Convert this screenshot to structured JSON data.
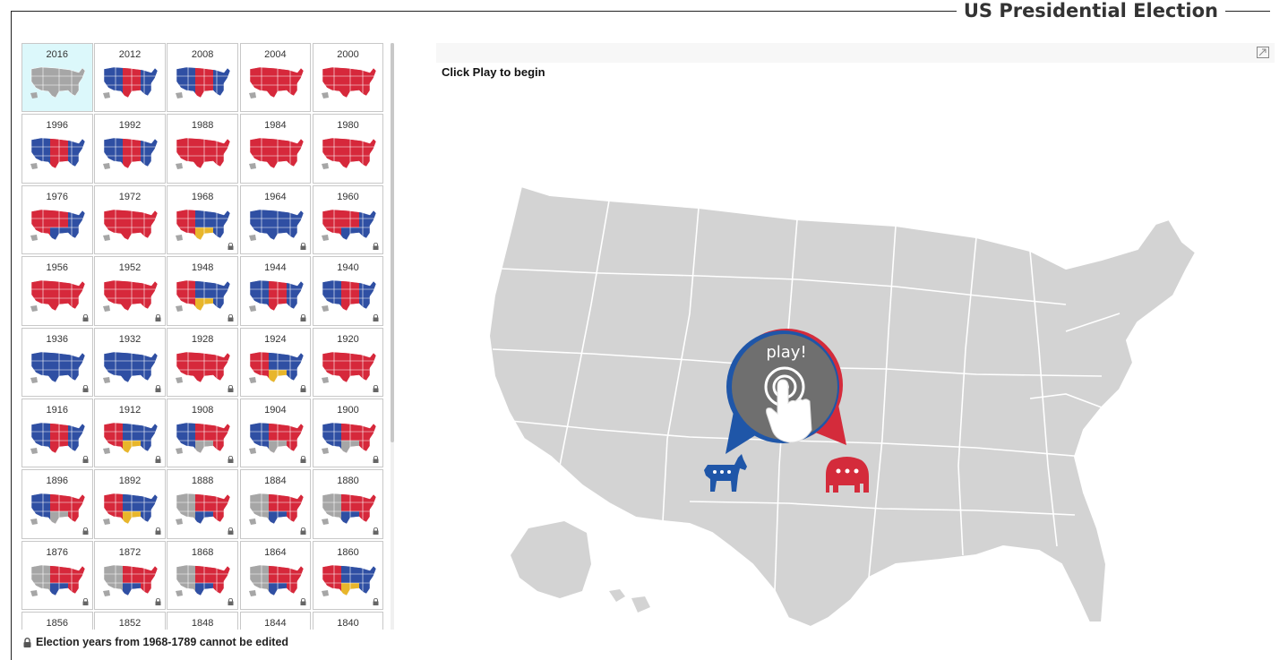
{
  "header": {
    "title": "US Presidential Election"
  },
  "grid": {
    "years": [
      {
        "year": "2016",
        "scheme": "gray",
        "locked": false,
        "selected": true
      },
      {
        "year": "2012",
        "scheme": "bluewin",
        "locked": false
      },
      {
        "year": "2008",
        "scheme": "bluewin",
        "locked": false
      },
      {
        "year": "2004",
        "scheme": "redwin",
        "locked": false
      },
      {
        "year": "2000",
        "scheme": "redwin",
        "locked": false
      },
      {
        "year": "1996",
        "scheme": "bluewin",
        "locked": false
      },
      {
        "year": "1992",
        "scheme": "bluewin",
        "locked": false
      },
      {
        "year": "1988",
        "scheme": "redsweep",
        "locked": false
      },
      {
        "year": "1984",
        "scheme": "redsweep",
        "locked": false
      },
      {
        "year": "1980",
        "scheme": "redsweep",
        "locked": false
      },
      {
        "year": "1976",
        "scheme": "bluesouth",
        "locked": false
      },
      {
        "year": "1972",
        "scheme": "redsweep",
        "locked": false
      },
      {
        "year": "1968",
        "scheme": "third",
        "locked": true
      },
      {
        "year": "1964",
        "scheme": "bluesweep",
        "locked": true
      },
      {
        "year": "1960",
        "scheme": "bluesouth",
        "locked": true
      },
      {
        "year": "1956",
        "scheme": "redwin",
        "locked": true
      },
      {
        "year": "1952",
        "scheme": "redwin",
        "locked": true
      },
      {
        "year": "1948",
        "scheme": "third",
        "locked": true
      },
      {
        "year": "1944",
        "scheme": "bluewin",
        "locked": true
      },
      {
        "year": "1940",
        "scheme": "bluewin",
        "locked": true
      },
      {
        "year": "1936",
        "scheme": "bluesweep",
        "locked": true
      },
      {
        "year": "1932",
        "scheme": "bluesweep",
        "locked": true
      },
      {
        "year": "1928",
        "scheme": "redwin",
        "locked": true
      },
      {
        "year": "1924",
        "scheme": "third",
        "locked": true
      },
      {
        "year": "1920",
        "scheme": "redwin",
        "locked": true
      },
      {
        "year": "1916",
        "scheme": "bluewin",
        "locked": true
      },
      {
        "year": "1912",
        "scheme": "third",
        "locked": true
      },
      {
        "year": "1908",
        "scheme": "graysouth",
        "locked": true
      },
      {
        "year": "1904",
        "scheme": "graysouth",
        "locked": true
      },
      {
        "year": "1900",
        "scheme": "graysouth",
        "locked": true
      },
      {
        "year": "1896",
        "scheme": "graysouth",
        "locked": true
      },
      {
        "year": "1892",
        "scheme": "third",
        "locked": true
      },
      {
        "year": "1888",
        "scheme": "grayhalf",
        "locked": true
      },
      {
        "year": "1884",
        "scheme": "grayhalf",
        "locked": true
      },
      {
        "year": "1880",
        "scheme": "grayhalf",
        "locked": true
      },
      {
        "year": "1876",
        "scheme": "grayhalf",
        "locked": true
      },
      {
        "year": "1872",
        "scheme": "grayhalf",
        "locked": true
      },
      {
        "year": "1868",
        "scheme": "grayhalf",
        "locked": true
      },
      {
        "year": "1864",
        "scheme": "grayhalf",
        "locked": true
      },
      {
        "year": "1860",
        "scheme": "third",
        "locked": true
      },
      {
        "year": "1856",
        "scheme": "grayhalf",
        "locked": true
      },
      {
        "year": "1852",
        "scheme": "grayhalf",
        "locked": true
      },
      {
        "year": "1848",
        "scheme": "grayhalf",
        "locked": true
      },
      {
        "year": "1844",
        "scheme": "grayhalf",
        "locked": true
      },
      {
        "year": "1840",
        "scheme": "grayhalf",
        "locked": true
      }
    ]
  },
  "footnote": {
    "text": "Election years from 1968-1789 cannot be edited",
    "icon": "lock-icon"
  },
  "map": {
    "hint": "Click Play to begin",
    "play_label": "play!",
    "expand_icon": "expand-icon",
    "democrat_icon": "donkey-icon",
    "republican_icon": "elephant-icon"
  },
  "colors": {
    "democrat": "#2f4fa3",
    "republican": "#d6283b",
    "other": "#e8b62b",
    "unassigned": "#a6a6a6",
    "selected_tile": "#dcf8fb",
    "map_fill": "#d3d3d3",
    "play_circle": "#6f6f6f"
  }
}
